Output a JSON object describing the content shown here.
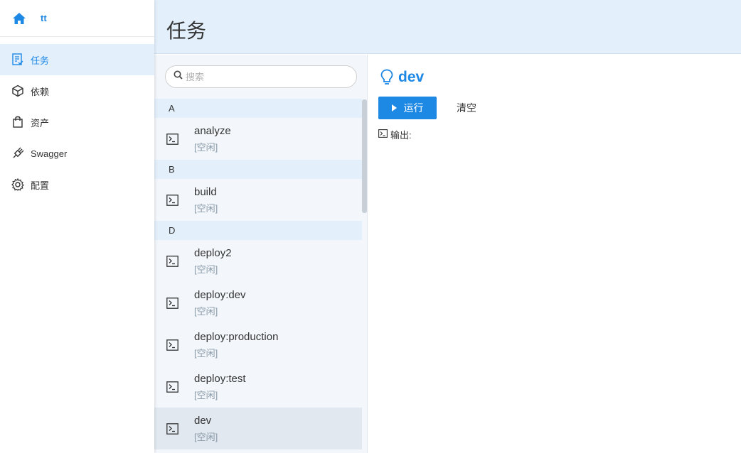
{
  "sidebar": {
    "project_name": "tt",
    "items": [
      {
        "label": "任务",
        "icon": "task-list-icon",
        "active": true
      },
      {
        "label": "依赖",
        "icon": "cube-icon",
        "active": false
      },
      {
        "label": "资产",
        "icon": "bag-icon",
        "active": false
      },
      {
        "label": "Swagger",
        "icon": "plug-icon",
        "active": false
      },
      {
        "label": "配置",
        "icon": "gear-icon",
        "active": false
      }
    ]
  },
  "header": {
    "title": "任务"
  },
  "search": {
    "placeholder": "搜索"
  },
  "groups": [
    {
      "letter": "A",
      "tasks": [
        {
          "name": "analyze",
          "status": "[空闲]"
        }
      ]
    },
    {
      "letter": "B",
      "tasks": [
        {
          "name": "build",
          "status": "[空闲]"
        }
      ]
    },
    {
      "letter": "D",
      "tasks": [
        {
          "name": "deploy2",
          "status": "[空闲]"
        },
        {
          "name": "deploy:dev",
          "status": "[空闲]"
        },
        {
          "name": "deploy:production",
          "status": "[空闲]"
        },
        {
          "name": "deploy:test",
          "status": "[空闲]"
        },
        {
          "name": "dev",
          "status": "[空闲]",
          "selected": true
        }
      ]
    }
  ],
  "detail": {
    "title": "dev",
    "run_label": "运行",
    "clear_label": "清空",
    "output_label": "输出:"
  },
  "colors": {
    "accent": "#1e88e5",
    "header_bg": "#e3f0fc",
    "list_bg": "#f3f7fb",
    "selected_bg": "#e1e8f0"
  }
}
